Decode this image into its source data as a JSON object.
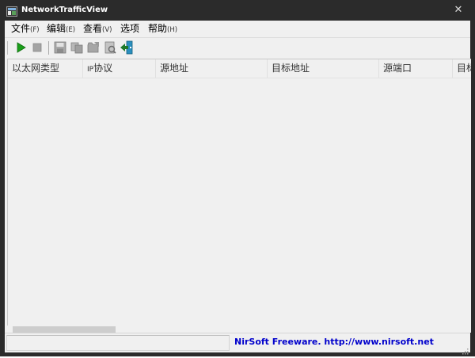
{
  "window": {
    "title": "NetworkTrafficView"
  },
  "menu": {
    "items": [
      {
        "label": "文件",
        "accel": "(F)"
      },
      {
        "label": "编辑",
        "accel": "(E)"
      },
      {
        "label": "查看",
        "accel": "(V)"
      },
      {
        "label": "选项",
        "accel": ""
      },
      {
        "label": "帮助",
        "accel": "(H)"
      }
    ]
  },
  "toolbar": {
    "buttons": [
      {
        "icon": "play-icon",
        "color": "#1a9e1a"
      },
      {
        "icon": "stop-icon",
        "color": "#a0a0a0"
      },
      {
        "icon": "save-icon",
        "color": "#a0a0a0"
      },
      {
        "icon": "copy-icon",
        "color": "#a0a0a0"
      },
      {
        "icon": "folder-icon",
        "color": "#a0a0a0"
      },
      {
        "icon": "properties-icon",
        "color": "#a0a0a0"
      },
      {
        "icon": "exit-icon",
        "color": "#1e9ec0"
      }
    ]
  },
  "columns": {
    "c1": "以太网类型",
    "c2_prefix": "IP",
    "c2_rest": "协议",
    "c3": "源地址",
    "c4": "目标地址",
    "c5": "源端口",
    "c6": "目标"
  },
  "status": {
    "pane1": "",
    "credit": "NirSoft Freeware.  http://www.nirsoft.net"
  },
  "colors": {
    "link": "#0000cc",
    "titlebar": "#2b2b2b",
    "client": "#f0f0f0"
  }
}
